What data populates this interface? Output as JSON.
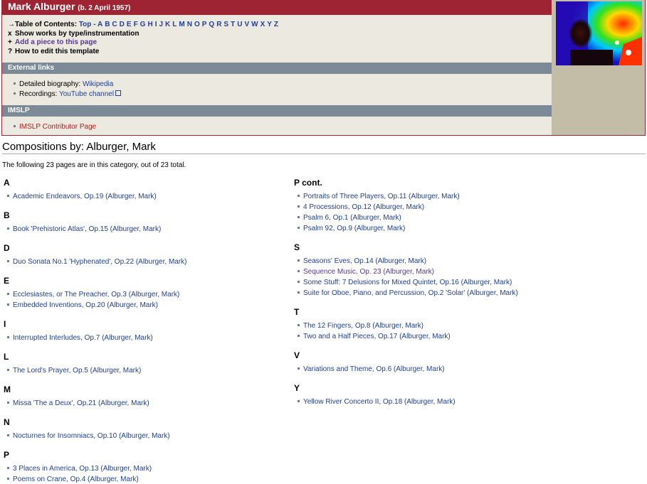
{
  "header": {
    "composer": "Mark Alburger",
    "dates": "(b. 2 April 1957)"
  },
  "toc": {
    "label": "Table of Contents:",
    "top": "Top",
    "dash": "-",
    "letters": [
      "A",
      "B",
      "C",
      "D",
      "E",
      "F",
      "G",
      "H",
      "I",
      "J",
      "K",
      "L",
      "M",
      "N",
      "O",
      "P",
      "Q",
      "R",
      "S",
      "T",
      "U",
      "V",
      "W",
      "X",
      "Y",
      "Z"
    ],
    "show_works": "Show works by type/instrumentation",
    "add_piece": "Add a piece to this page",
    "how_to_edit": "How to edit this template",
    "arrow_mark": "→",
    "x_mark": "x",
    "plus_mark": "+",
    "q_mark": "?"
  },
  "external_links": {
    "title": "External links",
    "bio_label": "Detailed biography:",
    "bio_link": "Wikipedia",
    "rec_label": "Recordings:",
    "rec_link": "YouTube channel"
  },
  "imslp": {
    "title": "IMSLP",
    "contributor": "IMSLP Contributor Page"
  },
  "compositions": {
    "title": "Compositions by: Alburger, Mark",
    "summary": "The following 23 pages are in this category, out of 23 total.",
    "left": [
      {
        "letter": "A",
        "items": [
          "Academic Endeavors, Op.19 (Alburger, Mark)"
        ]
      },
      {
        "letter": "B",
        "items": [
          "Book 'Prehistoric Atlas', Op.15 (Alburger, Mark)"
        ]
      },
      {
        "letter": "D",
        "items": [
          "Duo Sonata No.1 'Hyphenated', Op.22 (Alburger, Mark)"
        ]
      },
      {
        "letter": "E",
        "items": [
          "Ecclesiastes, or The Preacher, Op.3 (Alburger, Mark)",
          "Embedded Inventions, Op.20 (Alburger, Mark)"
        ]
      },
      {
        "letter": "I",
        "items": [
          "Interrupted Interludes, Op.7 (Alburger, Mark)"
        ]
      },
      {
        "letter": "L",
        "items": [
          "The Lord's Prayer, Op.5 (Alburger, Mark)"
        ]
      },
      {
        "letter": "M",
        "items": [
          "Missa 'The a Deux', Op.21 (Alburger, Mark)"
        ]
      },
      {
        "letter": "N",
        "items": [
          "Nocturnes for Insomniacs, Op.10 (Alburger, Mark)"
        ]
      },
      {
        "letter": "P",
        "items": [
          "3 Places in America, Op.13 (Alburger, Mark)",
          "Poems on Crane, Op.4 (Alburger, Mark)"
        ]
      }
    ],
    "right": [
      {
        "letter": "P cont.",
        "items": [
          "Portraits of Three Players, Op.11 (Alburger, Mark)",
          "4 Processions, Op.12 (Alburger, Mark)",
          "Psalm 6, Op.1 (Alburger, Mark)",
          "Psalm 92, Op.9 (Alburger, Mark)"
        ]
      },
      {
        "letter": "S",
        "items": [
          "Seasons' Eves, Op.14 (Alburger, Mark)",
          "Sequence Music, Op. 23 (Alburger, Mark)",
          "Some Stuff: 7 Delusions for Mixed Quintet, Op.16 (Alburger, Mark)",
          "Suite for Oboe, Piano, and Percussion, Op.2 'Solar' (Alburger, Mark)"
        ]
      },
      {
        "letter": "T",
        "items": [
          "The 12 Fingers, Op.8 (Alburger, Mark)",
          "Two and a Half Pieces, Op.17 (Alburger, Mark)"
        ]
      },
      {
        "letter": "V",
        "items": [
          "Variations and Theme, Op.6 (Alburger, Mark)"
        ]
      },
      {
        "letter": "Y",
        "items": [
          "Yellow River Concerto II, Op.18 (Alburger, Mark)"
        ]
      }
    ]
  },
  "colors": {
    "header_bar": "#9e2433",
    "section_bar": "#7b8a96",
    "link": "#1f3f99",
    "visited": "#5a3696",
    "imslp_link": "#b51a1a"
  }
}
